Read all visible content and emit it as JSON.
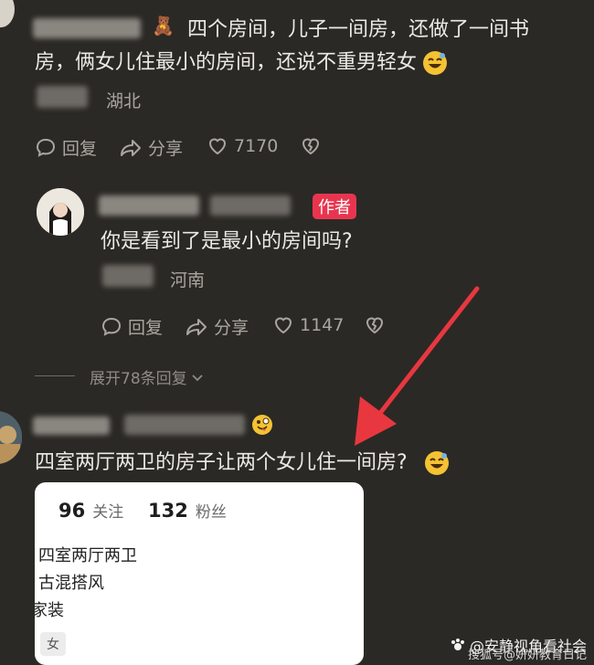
{
  "comment1": {
    "line1": "四个房间，儿子一间房，还做了一间书",
    "line2": "房，俩女儿住最小的房间，还说不重男轻女",
    "location": "湖北",
    "reply_label": "回复",
    "share_label": "分享",
    "likes": "7170"
  },
  "reply1": {
    "author_tag": "作者",
    "text": "你是看到了是最小的房间吗?",
    "location": "河南",
    "reply_label": "回复",
    "share_label": "分享",
    "likes": "1147"
  },
  "expand": {
    "label": "展开78条回复"
  },
  "comment2": {
    "text": "四室两厅两卫的房子让两个女儿住一间房?"
  },
  "profile_card": {
    "following_count": "96",
    "following_label": "关注",
    "followers_count": "132",
    "followers_label": "粉丝",
    "bio_line1": "四室两厅两卫",
    "bio_line2": "古混搭风",
    "bio_line3": "家装",
    "gender": "女"
  },
  "watermark": {
    "line1": "@安静视角看社会",
    "line2": "搜狐号@妍妍教育日记"
  },
  "colors": {
    "background": "#2b2925",
    "author_tag": "#e8354f",
    "annotation_arrow": "#e8373f"
  }
}
